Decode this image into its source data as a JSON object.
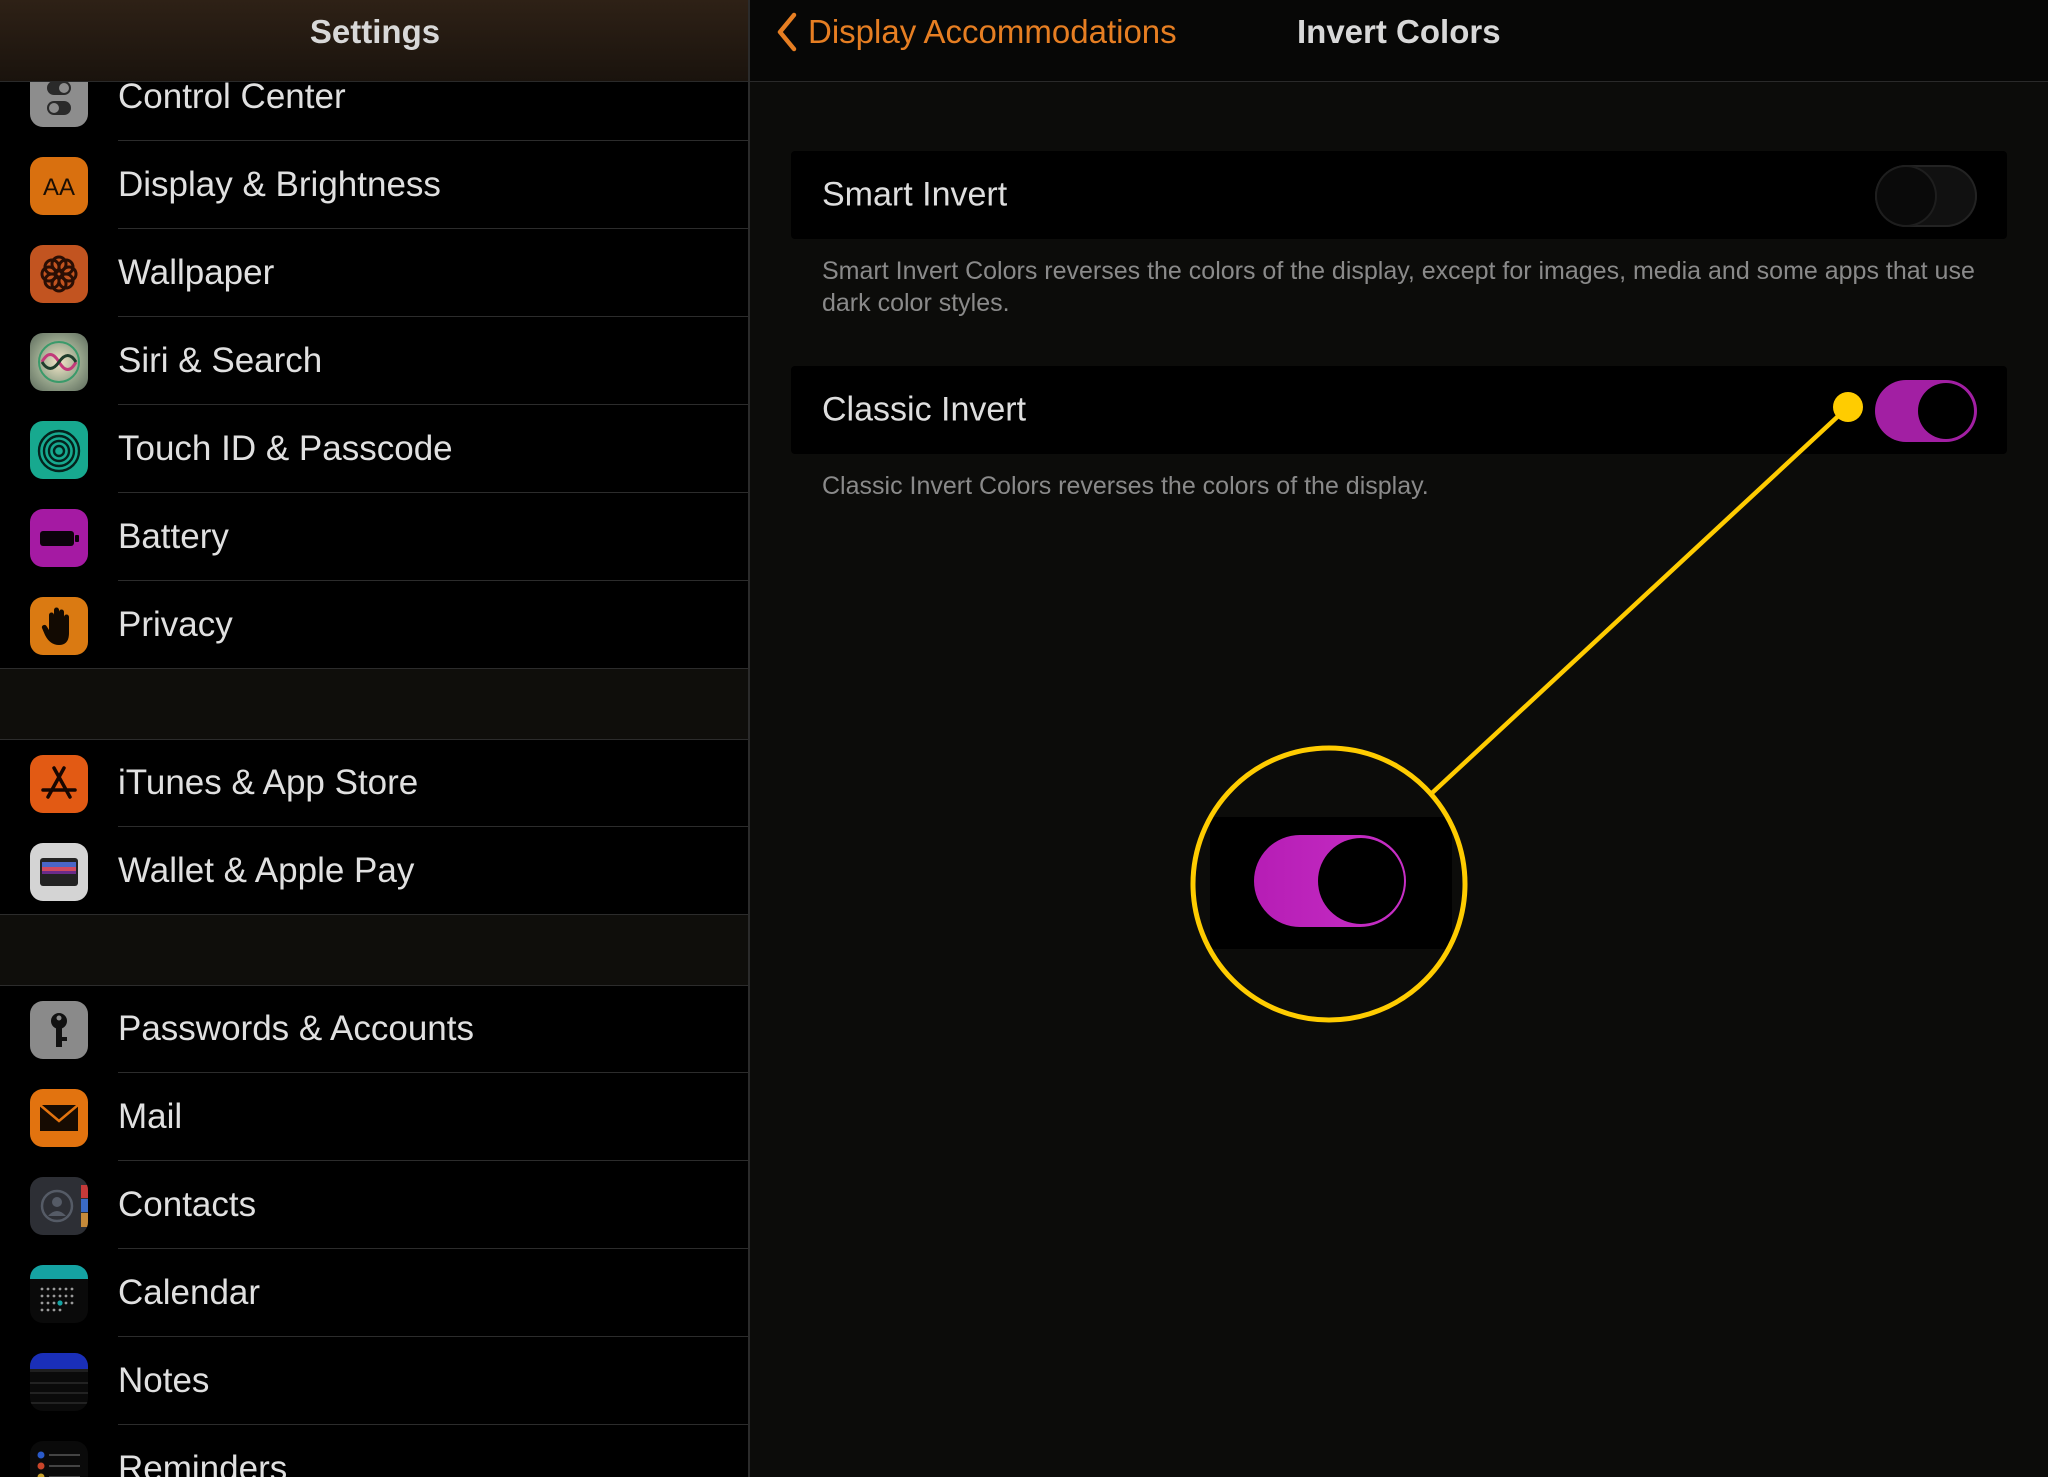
{
  "sidebar": {
    "title": "Settings",
    "groups": [
      [
        {
          "label": "Control Center",
          "icon": "control-center-icon"
        },
        {
          "label": "Display & Brightness",
          "icon": "display-brightness-icon"
        },
        {
          "label": "Wallpaper",
          "icon": "wallpaper-icon"
        },
        {
          "label": "Siri & Search",
          "icon": "siri-icon"
        },
        {
          "label": "Touch ID & Passcode",
          "icon": "fingerprint-icon"
        },
        {
          "label": "Battery",
          "icon": "battery-icon"
        },
        {
          "label": "Privacy",
          "icon": "privacy-hand-icon"
        }
      ],
      [
        {
          "label": "iTunes & App Store",
          "icon": "app-store-icon"
        },
        {
          "label": "Wallet & Apple Pay",
          "icon": "wallet-icon"
        }
      ],
      [
        {
          "label": "Passwords & Accounts",
          "icon": "key-icon"
        },
        {
          "label": "Mail",
          "icon": "mail-icon"
        },
        {
          "label": "Contacts",
          "icon": "contacts-icon"
        },
        {
          "label": "Calendar",
          "icon": "calendar-icon"
        },
        {
          "label": "Notes",
          "icon": "notes-icon"
        },
        {
          "label": "Reminders",
          "icon": "reminders-icon"
        }
      ]
    ]
  },
  "header": {
    "back_label": "Display Accommodations",
    "title": "Invert Colors"
  },
  "settings": {
    "smart_invert": {
      "label": "Smart Invert",
      "enabled": false,
      "footnote": "Smart Invert Colors reverses the colors of the display, except for images, media and some apps that use dark color styles."
    },
    "classic_invert": {
      "label": "Classic Invert",
      "enabled": true,
      "footnote": "Classic Invert Colors reverses the colors of the display."
    }
  },
  "colors": {
    "accent": "#e67e22",
    "toggle_on": "#a21fa3",
    "callout": "#ffcc00"
  }
}
